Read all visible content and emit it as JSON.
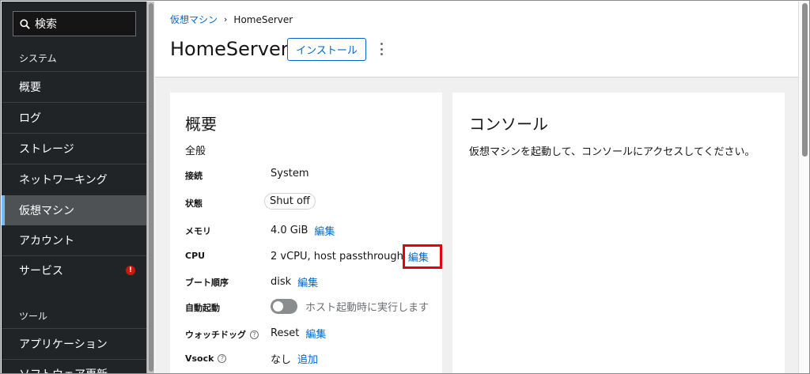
{
  "sidebar": {
    "search_label": "検索",
    "section_system": "システム",
    "items": [
      "概要",
      "ログ",
      "ストレージ",
      "ネットワーキング",
      "仮想マシン",
      "アカウント",
      "サービス"
    ],
    "active_item": "仮想マシン",
    "services_badge": "!",
    "section_tools": "ツール",
    "tool_items": [
      "アプリケーション",
      "ソフトウェア更新"
    ]
  },
  "header": {
    "breadcrumb_parent": "仮想マシン",
    "breadcrumb_current": "HomeServer",
    "title": "HomeServer",
    "install_label": "インストール"
  },
  "overview": {
    "title": "概要",
    "general": "全般",
    "rows": {
      "connection": {
        "label": "接続",
        "value": "System"
      },
      "state": {
        "label": "状態",
        "value": "Shut off"
      },
      "memory": {
        "label": "メモリ",
        "value": "4.0 GiB",
        "action": "編集"
      },
      "cpu": {
        "label": "CPU",
        "value": "2 vCPU, host passthrough",
        "action": "編集"
      },
      "boot": {
        "label": "ブート順序",
        "value": "disk",
        "action": "編集"
      },
      "autostart": {
        "label": "自動起動",
        "toggle_label": "ホスト起動時に実行します",
        "enabled": false
      },
      "watchdog": {
        "label": "ウォッチドッグ",
        "value": "Reset",
        "action": "編集"
      },
      "vsock": {
        "label": "Vsock",
        "value": "なし",
        "action": "追加"
      }
    }
  },
  "console": {
    "title": "コンソール",
    "message": "仮想マシンを起動して、コンソールにアクセスしてください。"
  },
  "colors": {
    "accent": "#0066cc",
    "sidebar_bg": "#212427",
    "highlight": "#e3000f",
    "badge": "#c9190b"
  }
}
